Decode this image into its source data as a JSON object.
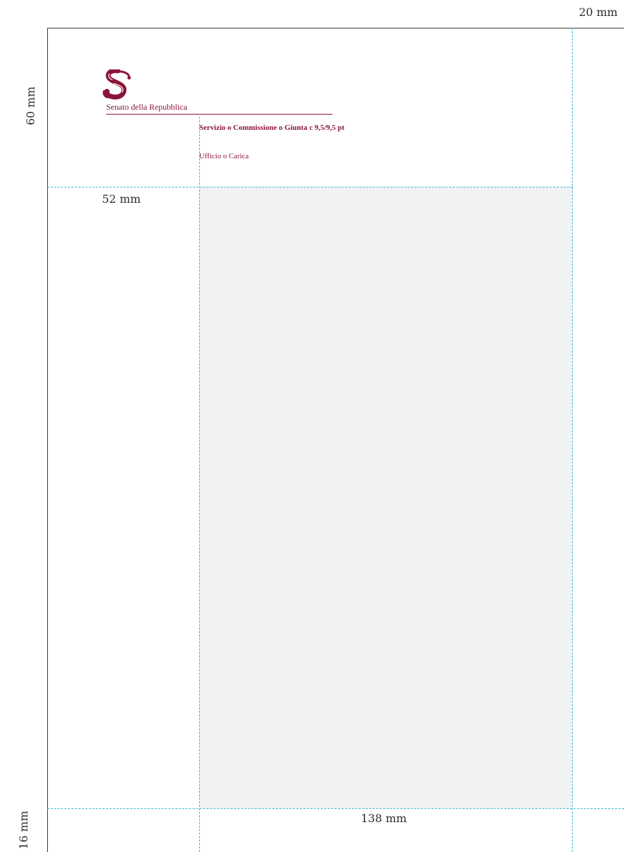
{
  "dimensions": {
    "right_margin": "20 mm",
    "top_band": "60 mm",
    "left_column": "52 mm",
    "bottom_margin": "16 mm",
    "body_width": "138 mm"
  },
  "letterhead": {
    "logo_icon": "senato-s-emblem-icon",
    "org_name": "Senato della Repubblica",
    "service_line": "Servizio o Commissione o Giunta c 9,5/9,5 pt",
    "office_line": "Ufficio o Carica"
  },
  "colors": {
    "brand": "#8b1538",
    "guide": "#39b6d6",
    "body_area": "#f1f2f4"
  }
}
